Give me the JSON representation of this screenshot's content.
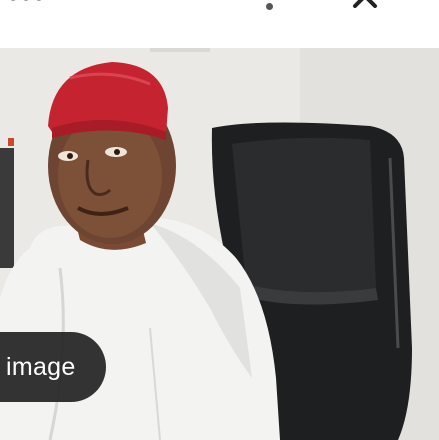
{
  "photo": {
    "alt": ""
  },
  "badge": {
    "label": "image"
  },
  "colors": {
    "cap_red": "#c4232f",
    "chair_black": "#1f2021",
    "garment_white": "#f2f2f0",
    "wall": "#eceae6",
    "badge_bg": "#232323"
  },
  "icons": [
    "chevron-up-icon",
    "dot-indicator"
  ]
}
